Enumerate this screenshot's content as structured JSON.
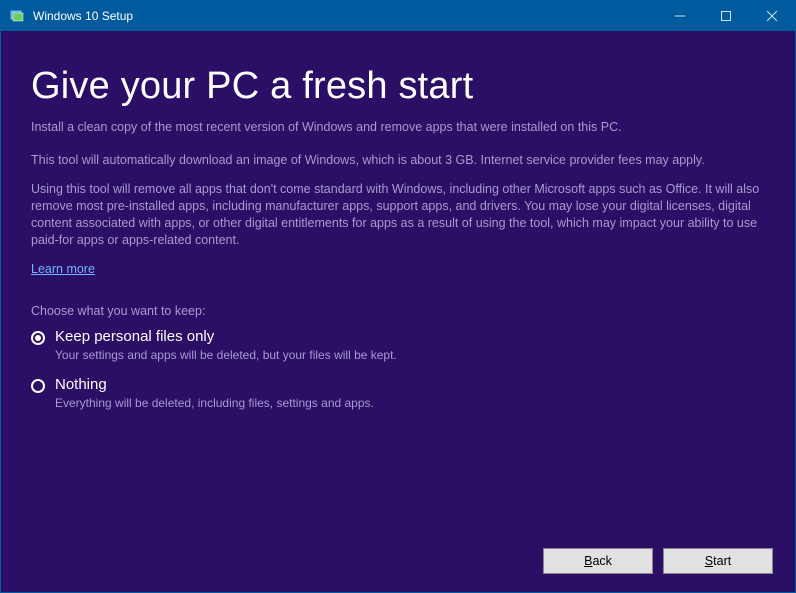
{
  "titlebar": {
    "title": "Windows 10 Setup"
  },
  "main": {
    "heading": "Give your PC a fresh start",
    "lead": "Install a clean copy of the most recent version of Windows and remove apps that were installed on this PC.",
    "para1": "This tool will automatically download an image of Windows, which is about 3 GB.  Internet service provider fees may apply.",
    "para2": "Using this tool will remove all apps that don't come standard with Windows, including other Microsoft apps such as Office. It will also remove most pre-installed apps, including manufacturer apps, support apps, and drivers. You may lose your digital licenses, digital content associated with apps, or other digital entitlements for apps as a result of using the tool, which may impact your ability to use paid-for apps or apps-related content.",
    "learn_more": "Learn more",
    "choose_label": "Choose what you want to keep:",
    "options": [
      {
        "label": "Keep personal files only",
        "desc": "Your settings and apps will be deleted, but your files will be kept.",
        "selected": true
      },
      {
        "label": "Nothing",
        "desc": "Everything will be deleted, including files, settings and apps.",
        "selected": false
      }
    ]
  },
  "footer": {
    "back_prefix": "B",
    "back_rest": "ack",
    "start_prefix": "S",
    "start_rest": "tart"
  }
}
